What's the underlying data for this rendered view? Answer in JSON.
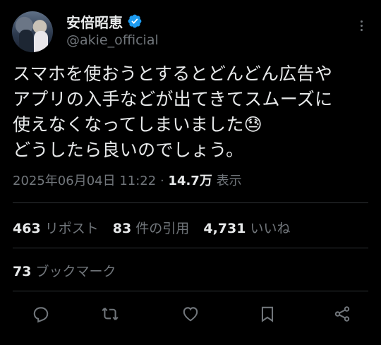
{
  "header": {
    "display_name": "安倍昭恵",
    "handle": "@akie_official"
  },
  "tweet": {
    "lines": [
      "スマホを使おうとするとどんどん広告や",
      "アプリの入手などが出てきてスムーズに",
      "使えなくなってしまいました😓",
      "どうしたら良いのでしょう。"
    ]
  },
  "meta": {
    "timestamp": "2025年06月04日 11:22",
    "separator": "·",
    "views_count": "14.7万",
    "views_label": "表示"
  },
  "stats": {
    "reposts_count": "463",
    "reposts_label": "リポスト",
    "quotes_count": "83",
    "quotes_label": "件の引用",
    "likes_count": "4,731",
    "likes_label": "いいね",
    "bookmarks_count": "73",
    "bookmarks_label": "ブックマーク"
  },
  "colors": {
    "background": "#000000",
    "text": "#e7e9ea",
    "secondary": "#71767b",
    "verified": "#1d9bf0",
    "divider": "#2f3336"
  },
  "icons": [
    "verified-badge-icon",
    "more-icon",
    "reply-icon",
    "repost-icon",
    "like-icon",
    "bookmark-icon",
    "share-icon"
  ]
}
